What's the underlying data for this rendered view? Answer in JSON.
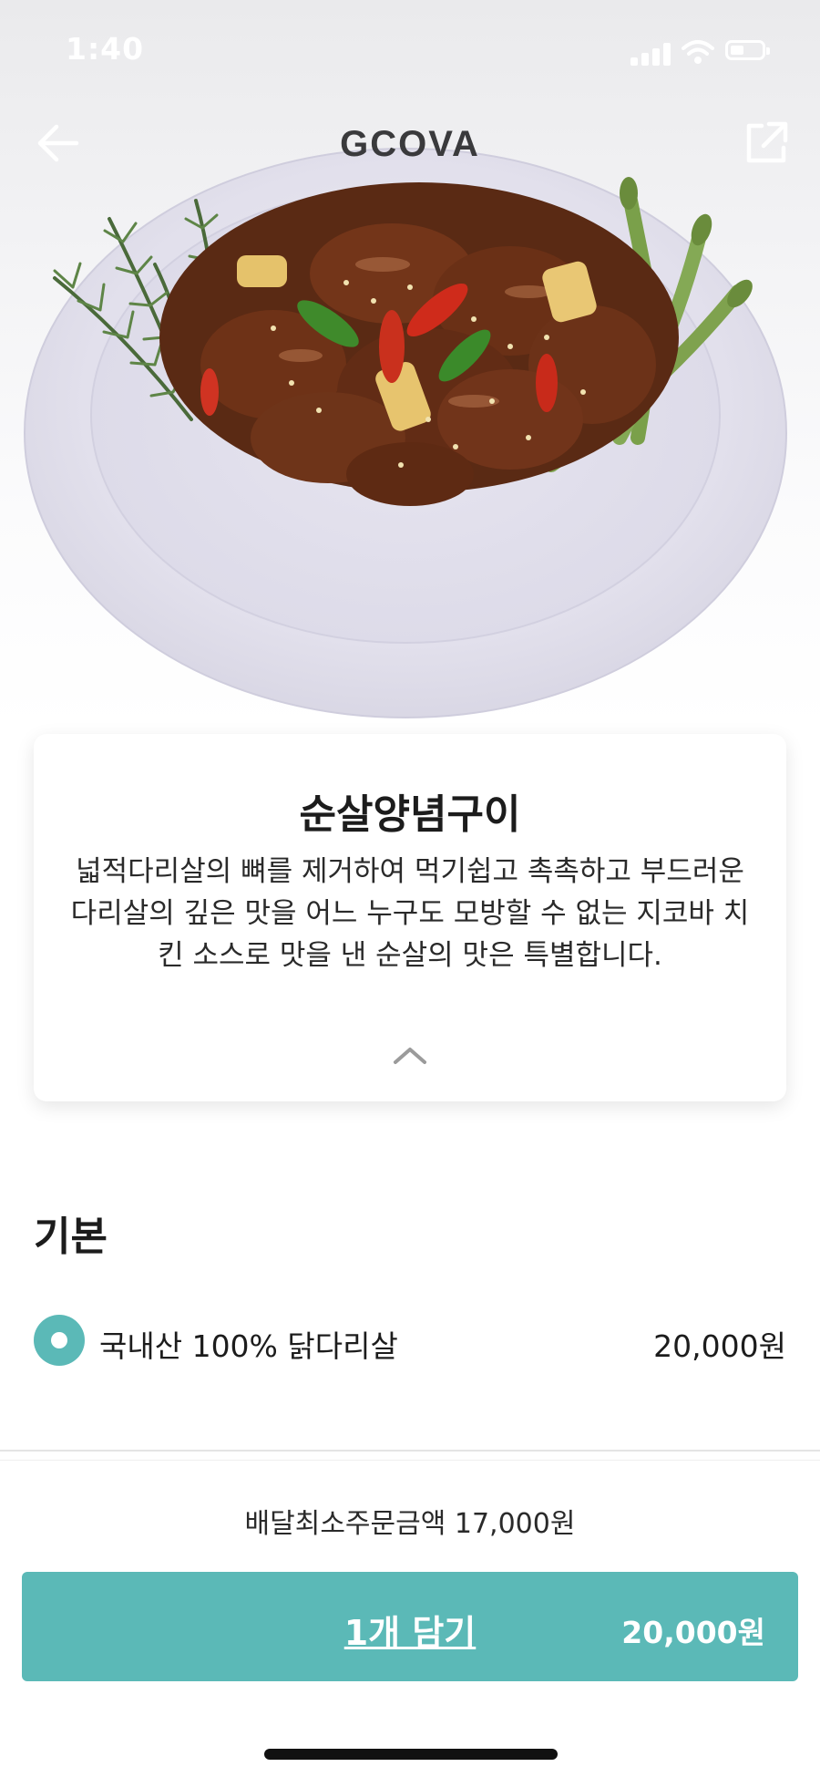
{
  "status_bar": {
    "time": "1:40"
  },
  "header": {
    "brand": "GCOVA"
  },
  "menu": {
    "name": "순살양념구이",
    "description": "넓적다리살의 뼈를 제거하여 먹기쉽고 촉촉하고 부드러운 다리살의 깊은 맛을 어느 누구도 모방할 수 없는 지코바 치킨 소스로 맛을 낸 순살의 맛은 특별합니다."
  },
  "options": {
    "section_title": "기본",
    "items": [
      {
        "label": "국내산 100% 닭다리살",
        "price": "20,000원",
        "selected": true
      }
    ]
  },
  "footer": {
    "min_order": "배달최소주문금액 17,000원",
    "cart_button_label": "1개 담기",
    "cart_button_price": "20,000원"
  },
  "colors": {
    "accent": "#5bb9b7",
    "background": "#ffffff",
    "text": "#1c1c1c"
  },
  "icons": [
    "back-arrow-icon",
    "share-icon",
    "chevron-up-icon",
    "radio-selected-icon",
    "signal-icon",
    "wifi-icon",
    "battery-icon"
  ]
}
